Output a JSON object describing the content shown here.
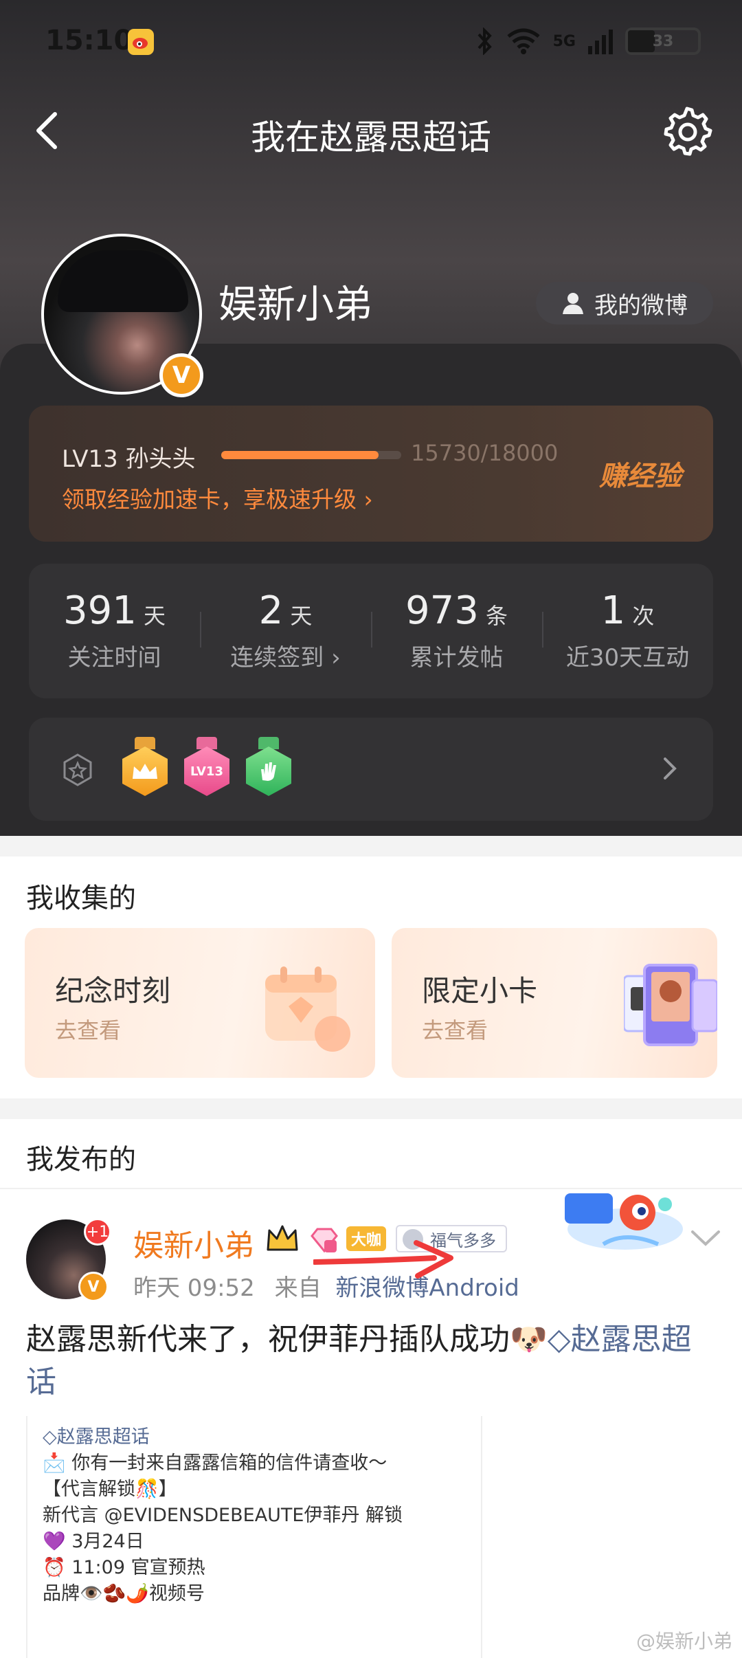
{
  "status_bar": {
    "time": "15:10",
    "network": "5G",
    "battery": "33"
  },
  "nav": {
    "title": "我在赵露思超话"
  },
  "profile": {
    "username": "娱新小弟",
    "my_weibo_label": "我的微博",
    "verified_mark": "V"
  },
  "level": {
    "name": "LV13 孙头头",
    "progress_text": "15730/18000",
    "progress_fraction": 0.874,
    "boost_link": "领取经验加速卡，享极速升级 ›",
    "earn_label": "赚经验"
  },
  "stats": [
    {
      "value": "391",
      "unit": "天",
      "label": "关注时间"
    },
    {
      "value": "2",
      "unit": "天",
      "label": "连续签到 ›"
    },
    {
      "value": "973",
      "unit": "条",
      "label": "累计发帖"
    },
    {
      "value": "1",
      "unit": "次",
      "label": "近30天互动"
    }
  ],
  "medals": {
    "lv_medal_text": "LV13"
  },
  "collection": {
    "title": "我收集的",
    "cards": [
      {
        "title": "纪念时刻",
        "sub": "去查看"
      },
      {
        "title": "限定小卡",
        "sub": "去查看"
      }
    ]
  },
  "published": {
    "title": "我发布的"
  },
  "post": {
    "author": "娱新小弟",
    "plus_badge": "+1",
    "dk_badge": "大咖",
    "fu_badge": "福气多多",
    "time": "昨天 09:52",
    "from": "来自",
    "source": "新浪微博Android",
    "text": "赵露思新代来了，祝伊菲丹插队成功",
    "topic": "赵露思超话",
    "card_topic": "赵露思超话",
    "card_lines": [
      "📩 你有一封来自露露信箱的信件请查收～",
      "",
      "【代言解锁🎊】",
      "新代言 @EVIDENSDEBEAUTE伊菲丹 解锁",
      "",
      "💜 3月24日",
      "⏰ 11:09 官宣预热",
      "品牌👁️🫘🌶️视频号"
    ],
    "watermark": "@娱新小弟"
  },
  "colors": {
    "accent_orange": "#ff8a3d",
    "link_blue": "#566b94",
    "verified": "#f39a1c"
  }
}
